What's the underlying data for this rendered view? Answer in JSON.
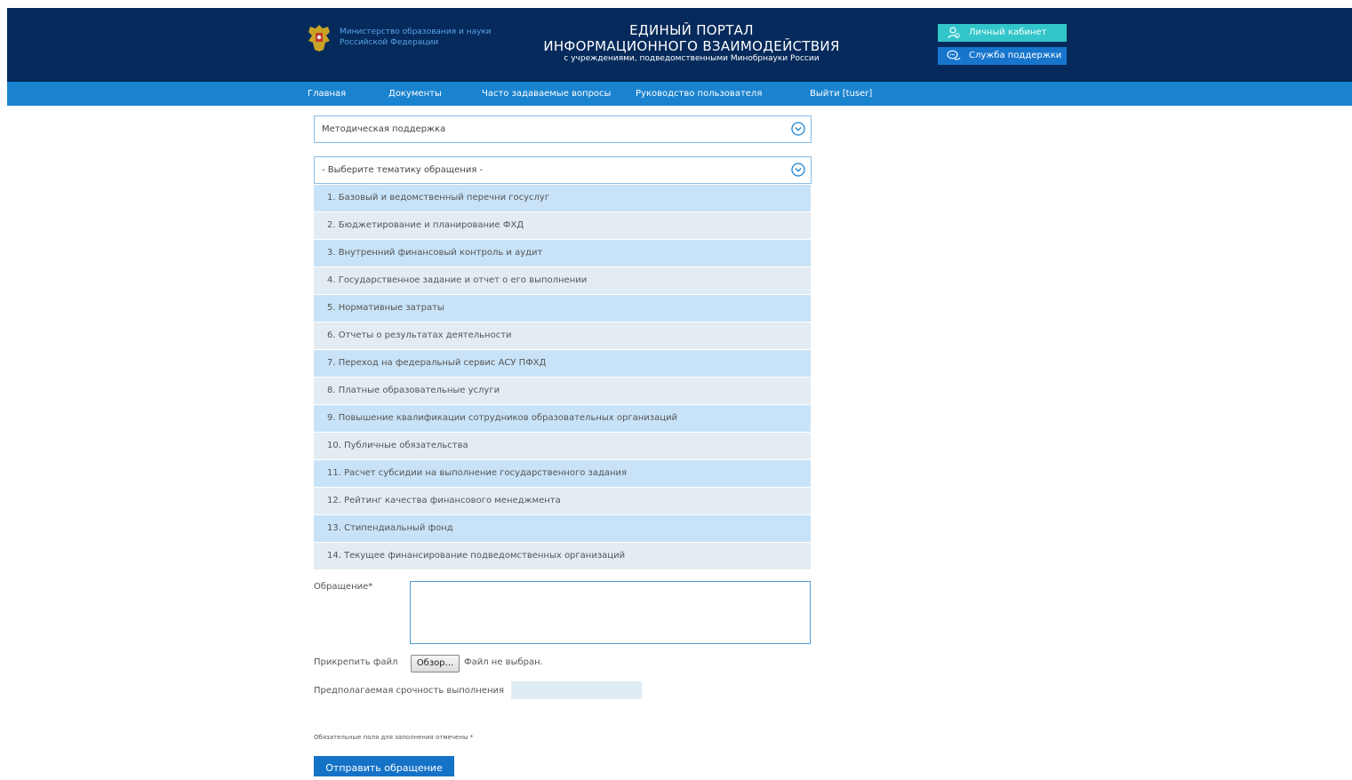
{
  "header": {
    "ministry_line1": "Министерство образования и науки",
    "ministry_line2": "Российской Федерации",
    "title_line1": "ЕДИНЫЙ ПОРТАЛ",
    "title_line2": "ИНФОРМАЦИОННОГО ВЗАИМОДЕЙСТВИЯ",
    "title_line3": "с учреждениями, подведомственными Минобрнауки России",
    "cabinet_label": "Личный кабинет",
    "support_label": "Служба поддержки",
    "cabinet_icon": "person-icon",
    "support_icon": "chat-icon"
  },
  "nav": {
    "items": [
      "Главная",
      "Документы",
      "Часто задаваемые вопросы",
      "Руководство пользователя",
      "Выйти [tuser]"
    ]
  },
  "form": {
    "category_select": "Методическая поддержка",
    "topic_select": "- Выберите тематику обращения -",
    "topic_options": [
      "1. Базовый и ведомственный перечни госуслуг",
      "2. Бюджетирование и планирование ФХД",
      "3. Внутренний финансовый контроль и аудит",
      "4. Государственное задание и отчет о его выполнении",
      "5. Нормативные затраты",
      "6. Отчеты о результатах деятельности",
      "7. Переход на федеральный сервис АСУ ПФХД",
      "8. Платные образовательные услуги",
      "9. Повышение квалификации сотрудников образовательных организаций",
      "10. Публичные обязательства",
      "11. Расчет субсидии на выполнение государственного задания",
      "12. Рейтинг качества финансового менеджмента",
      "13. Стипендиальный фонд",
      "14. Текущее финансирование подведомственных организаций"
    ],
    "message_label": "Обращение*",
    "message_value": "",
    "attach_label": "Прикрепить файл",
    "browse_button": "Обзор...",
    "no_file_text": "Файл не выбран.",
    "urgency_label": "Предполагаемая срочность выполнения",
    "urgency_value": "",
    "required_note": "Обязательные поля для заполнения отмечены *",
    "submit_label": "Отправить обращение"
  },
  "colors": {
    "header_bg": "#052a5b",
    "nav_bg": "#1a83cf",
    "cabinet_bg": "#32c5c9",
    "support_bg": "#1775cc",
    "option_odd": "#c8e3f8",
    "option_even": "#e3ecf3",
    "submit_bg": "#1573c7"
  }
}
